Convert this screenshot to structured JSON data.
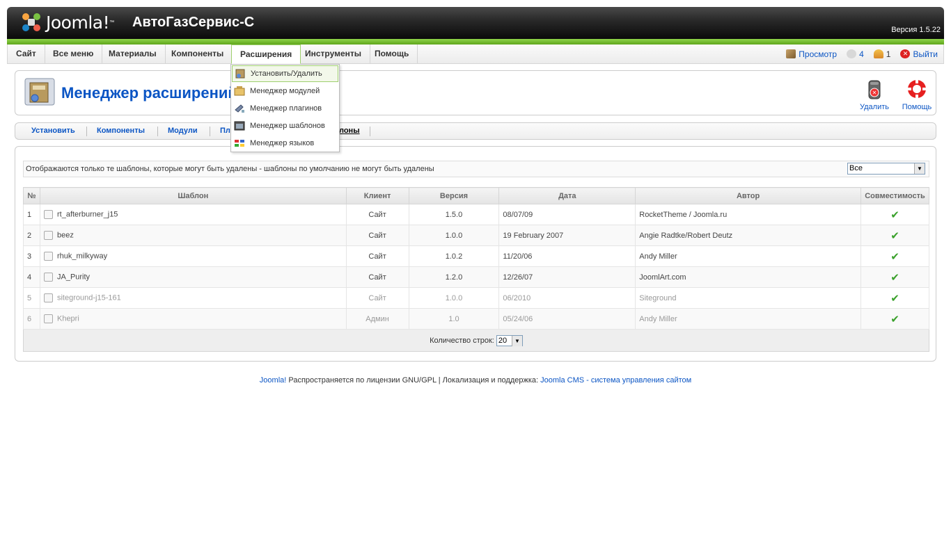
{
  "header": {
    "logo_text": "Joomla!",
    "site_name": "АвтоГазСервис-С",
    "version": "Версия 1.5.22"
  },
  "menubar": {
    "items": [
      "Сайт",
      "Все меню",
      "Материалы",
      "Компоненты",
      "Расширения",
      "Инструменты",
      "Помощь"
    ],
    "active": "Расширения",
    "status": {
      "preview_label": "Просмотр",
      "messages_count": "4",
      "users_count": "1",
      "logout_label": "Выйти"
    }
  },
  "dropdown": {
    "items": [
      "Установить/Удалить",
      "Менеджер модулей",
      "Менеджер плагинов",
      "Менеджер шаблонов",
      "Менеджер языков"
    ],
    "highlighted": "Установить/Удалить"
  },
  "toolbar": {
    "title": "Менеджер расширений",
    "delete_label": "Удалить",
    "help_label": "Помощь"
  },
  "submenu": {
    "items": [
      "Установить",
      "Компоненты",
      "Модули",
      "Пл",
      "лоны"
    ]
  },
  "filter": {
    "text": "Отображаются только те шаблоны, которые могут быть удалены - шаблоны по умолчанию не могут быть удалены",
    "select_value": "Все"
  },
  "table": {
    "headers": [
      "№",
      "Шаблон",
      "Клиент",
      "Версия",
      "Дата",
      "Автор",
      "Совместимость"
    ],
    "rows": [
      {
        "num": "1",
        "name": "rt_afterburner_j15",
        "client": "Сайт",
        "version": "1.5.0",
        "date": "08/07/09",
        "author": "RocketTheme / Joomla.ru",
        "compatible": "✔"
      },
      {
        "num": "2",
        "name": "beez",
        "client": "Сайт",
        "version": "1.0.0",
        "date": "19 February 2007",
        "author": "Angie Radtke/Robert Deutz",
        "compatible": "✔"
      },
      {
        "num": "3",
        "name": "rhuk_milkyway",
        "client": "Сайт",
        "version": "1.0.2",
        "date": "11/20/06",
        "author": "Andy Miller",
        "compatible": "✔"
      },
      {
        "num": "4",
        "name": "JA_Purity",
        "client": "Сайт",
        "version": "1.2.0",
        "date": "12/26/07",
        "author": "JoomlArt.com",
        "compatible": "✔"
      },
      {
        "num": "5",
        "name": "siteground-j15-161",
        "client": "Сайт",
        "version": "1.0.0",
        "date": "06/2010",
        "author": "Siteground",
        "compatible": "✔"
      },
      {
        "num": "6",
        "name": "Khepri",
        "client": "Админ",
        "version": "1.0",
        "date": "05/24/06",
        "author": "Andy Miller",
        "compatible": "✔"
      }
    ],
    "footer_label": "Количество строк:",
    "limit_value": "20"
  },
  "footer": {
    "link1": "Joomla!",
    "text1": " Распространяется по лицензии GNU/GPL | Локализация и поддержка: ",
    "link2": "Joomla CMS - система управления сайтом"
  },
  "colors": {
    "link_blue": "#0b55c4",
    "accent_green": "#6cb52b",
    "check_green": "#3aa12b"
  }
}
